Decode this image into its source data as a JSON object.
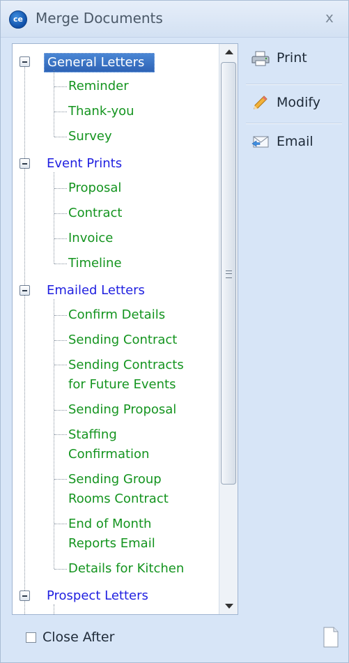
{
  "window": {
    "title": "Merge Documents",
    "close_glyph": "x",
    "app_icon_text": "ce"
  },
  "tree": {
    "groups": [
      {
        "label": "General Letters",
        "selected": true,
        "children": [
          "Reminder",
          "Thank-you",
          "Survey"
        ]
      },
      {
        "label": "Event Prints",
        "selected": false,
        "children": [
          "Proposal",
          "Contract",
          "Invoice",
          "Timeline"
        ]
      },
      {
        "label": "Emailed Letters",
        "selected": false,
        "children": [
          "Confirm Details",
          "Sending Contract",
          "Sending Contracts\nfor Future Events",
          "Sending Proposal",
          "Staffing\nConfirmation",
          "Sending Group\nRooms Contract",
          "End of Month\nReports Email",
          "Details for Kitchen"
        ]
      },
      {
        "label": "Prospect Letters",
        "selected": false,
        "children": []
      }
    ]
  },
  "actions": {
    "print": "Print",
    "modify": "Modify",
    "email": "Email"
  },
  "footer": {
    "close_after_label": "Close After",
    "close_after_checked": false
  },
  "colors": {
    "group_text": "#1f1fe0",
    "child_text": "#14941f",
    "selection": "#2e63b5"
  }
}
